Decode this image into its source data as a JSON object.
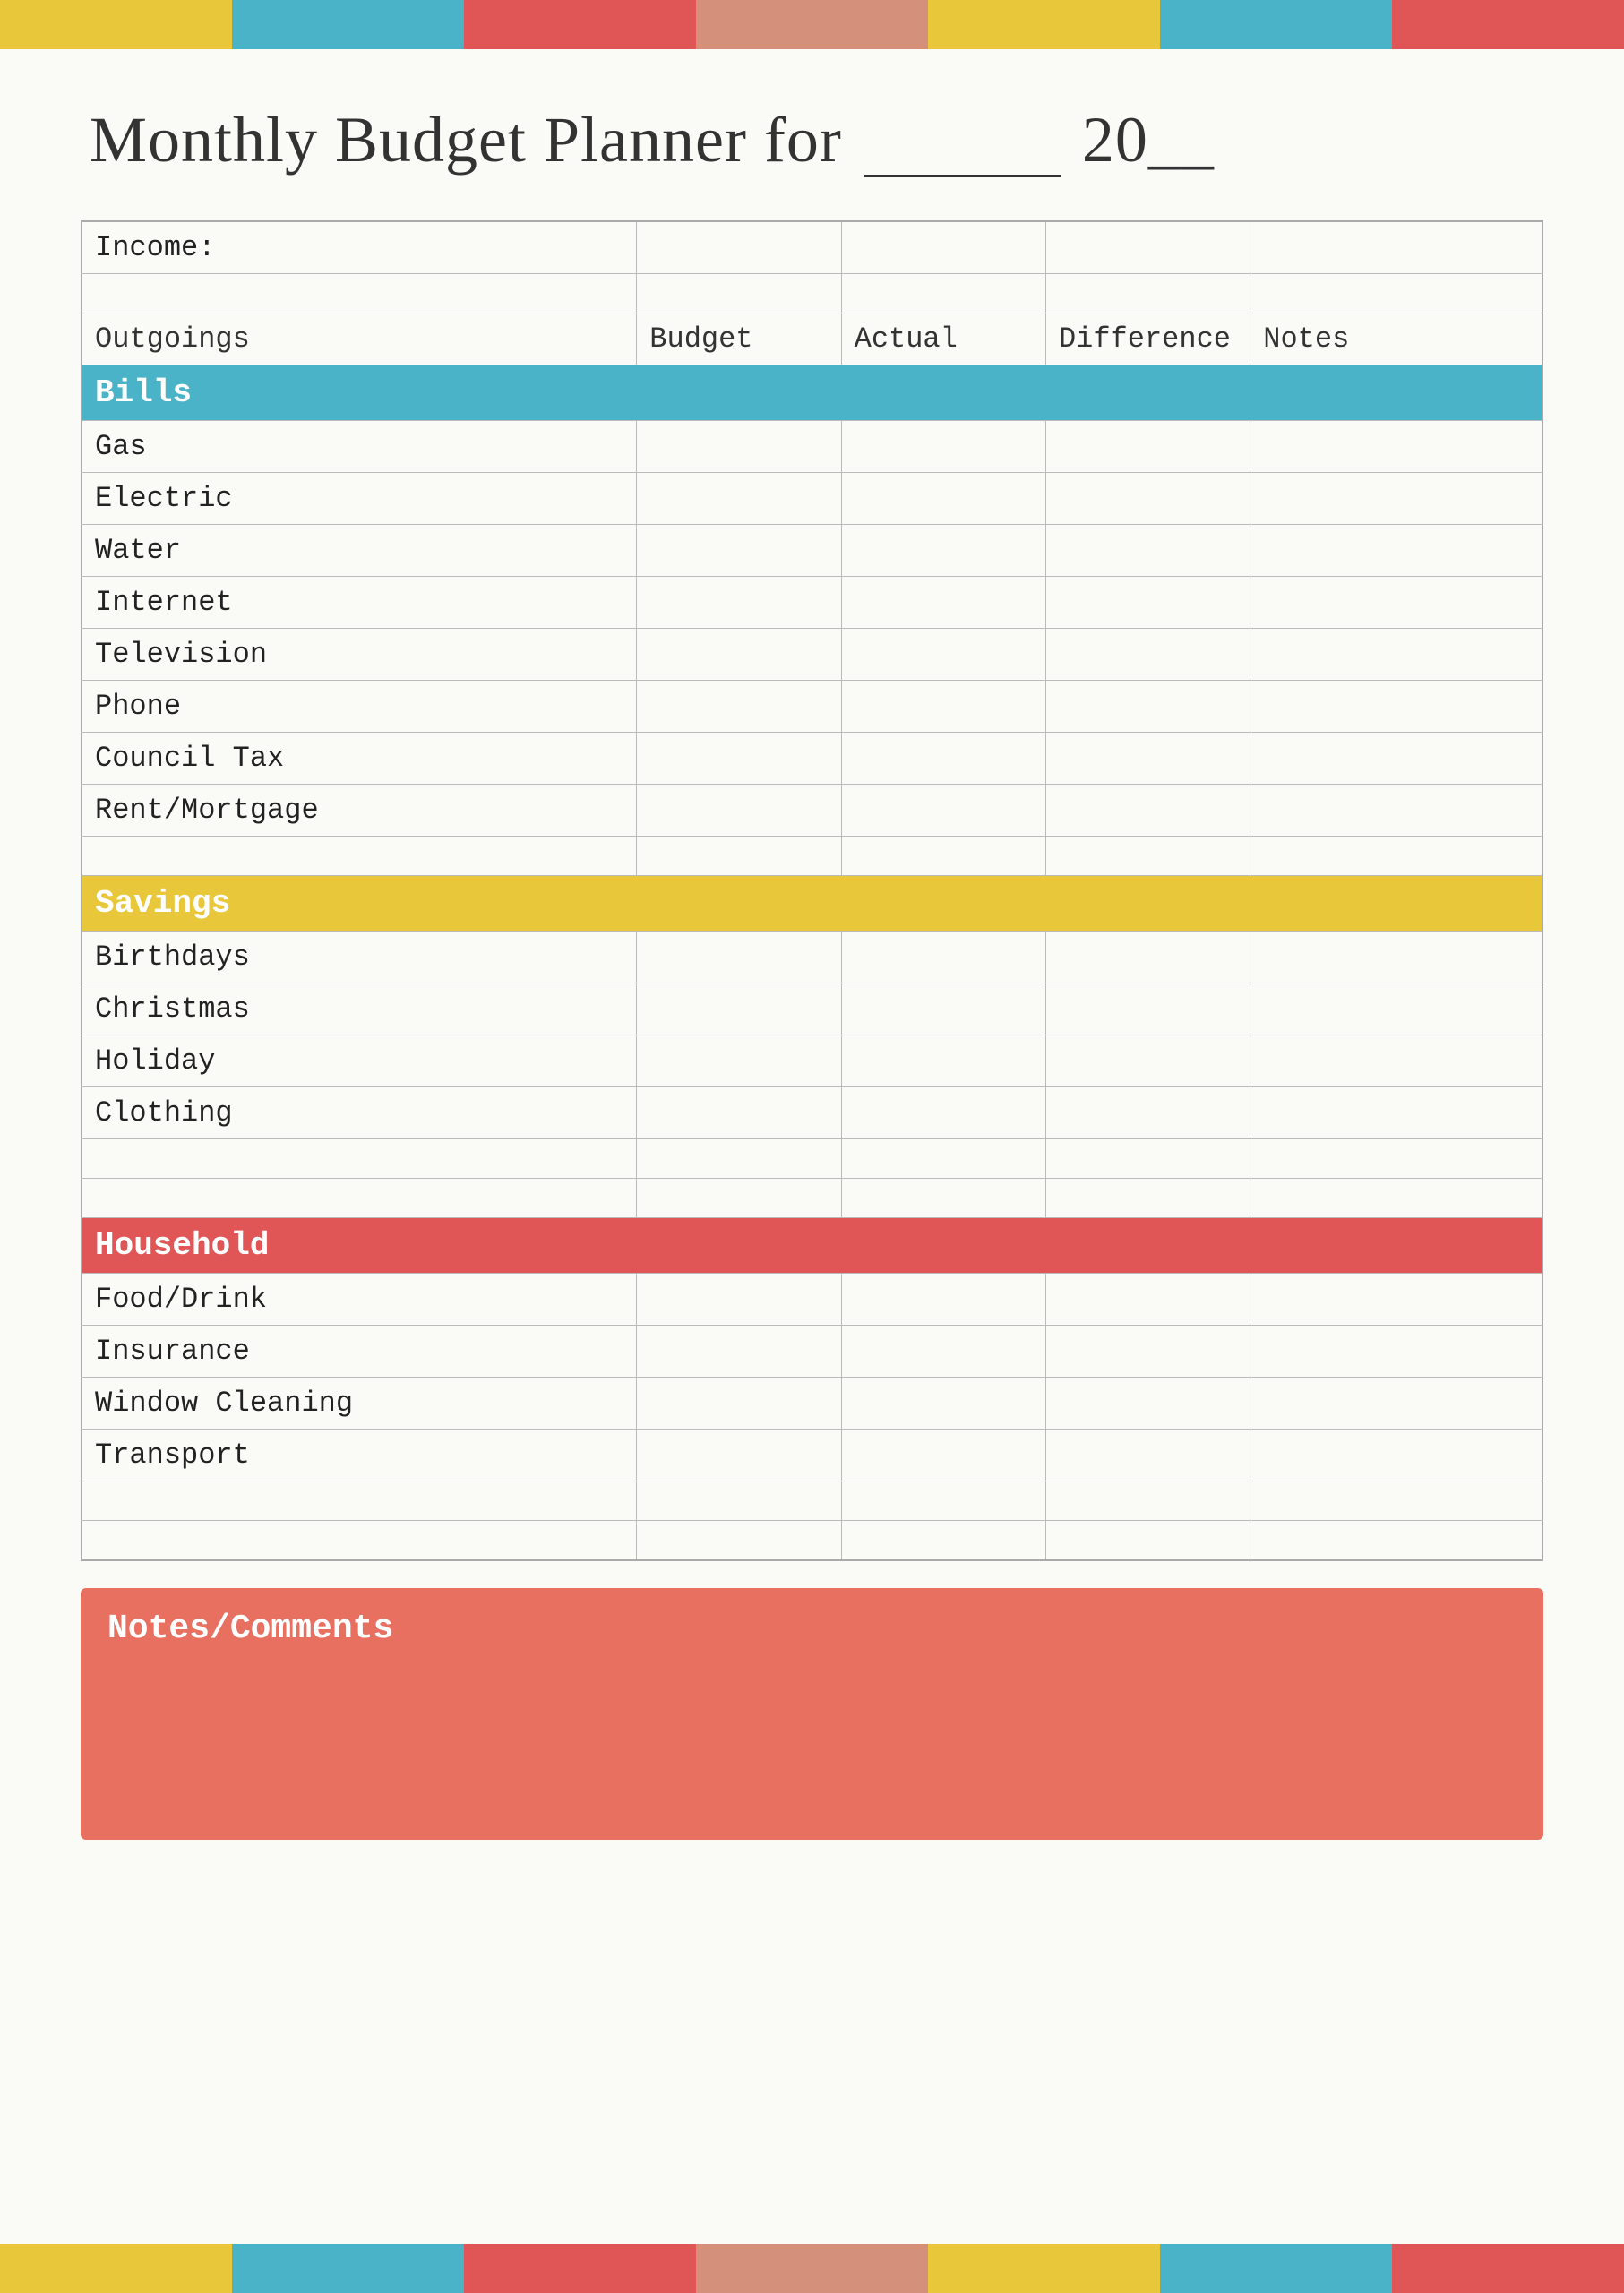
{
  "topBars": [
    {
      "color": "#e8c83a"
    },
    {
      "color": "#4ab3c8"
    },
    {
      "color": "#e05555"
    },
    {
      "color": "#d4907a"
    },
    {
      "color": "#e8c83a"
    },
    {
      "color": "#4ab3c8"
    },
    {
      "color": "#e05555"
    }
  ],
  "title": {
    "prefix": "Monthly Budget Planner for",
    "suffix": "20__"
  },
  "income": {
    "label": "Income:"
  },
  "outgoings": {
    "label": "Outgoings",
    "col_budget": "Budget",
    "col_actual": "Actual",
    "col_diff": "Difference",
    "col_notes": "Notes"
  },
  "sections": {
    "bills": {
      "label": "Bills",
      "items": [
        "Gas",
        "Electric",
        "Water",
        "Internet",
        "Television",
        "Phone",
        "Council Tax",
        "Rent/Mortgage"
      ]
    },
    "savings": {
      "label": "Savings",
      "items": [
        "Birthdays",
        "Christmas",
        "Holiday",
        "Clothing"
      ]
    },
    "household": {
      "label": "Household",
      "items": [
        "Food/Drink",
        "Insurance",
        "Window Cleaning",
        "Transport"
      ]
    }
  },
  "notes": {
    "title": "Notes/Comments"
  },
  "bottomBars": [
    {
      "color": "#e8c83a"
    },
    {
      "color": "#4ab3c8"
    },
    {
      "color": "#e05555"
    },
    {
      "color": "#d4907a"
    },
    {
      "color": "#e8c83a"
    },
    {
      "color": "#4ab3c8"
    },
    {
      "color": "#e05555"
    }
  ]
}
